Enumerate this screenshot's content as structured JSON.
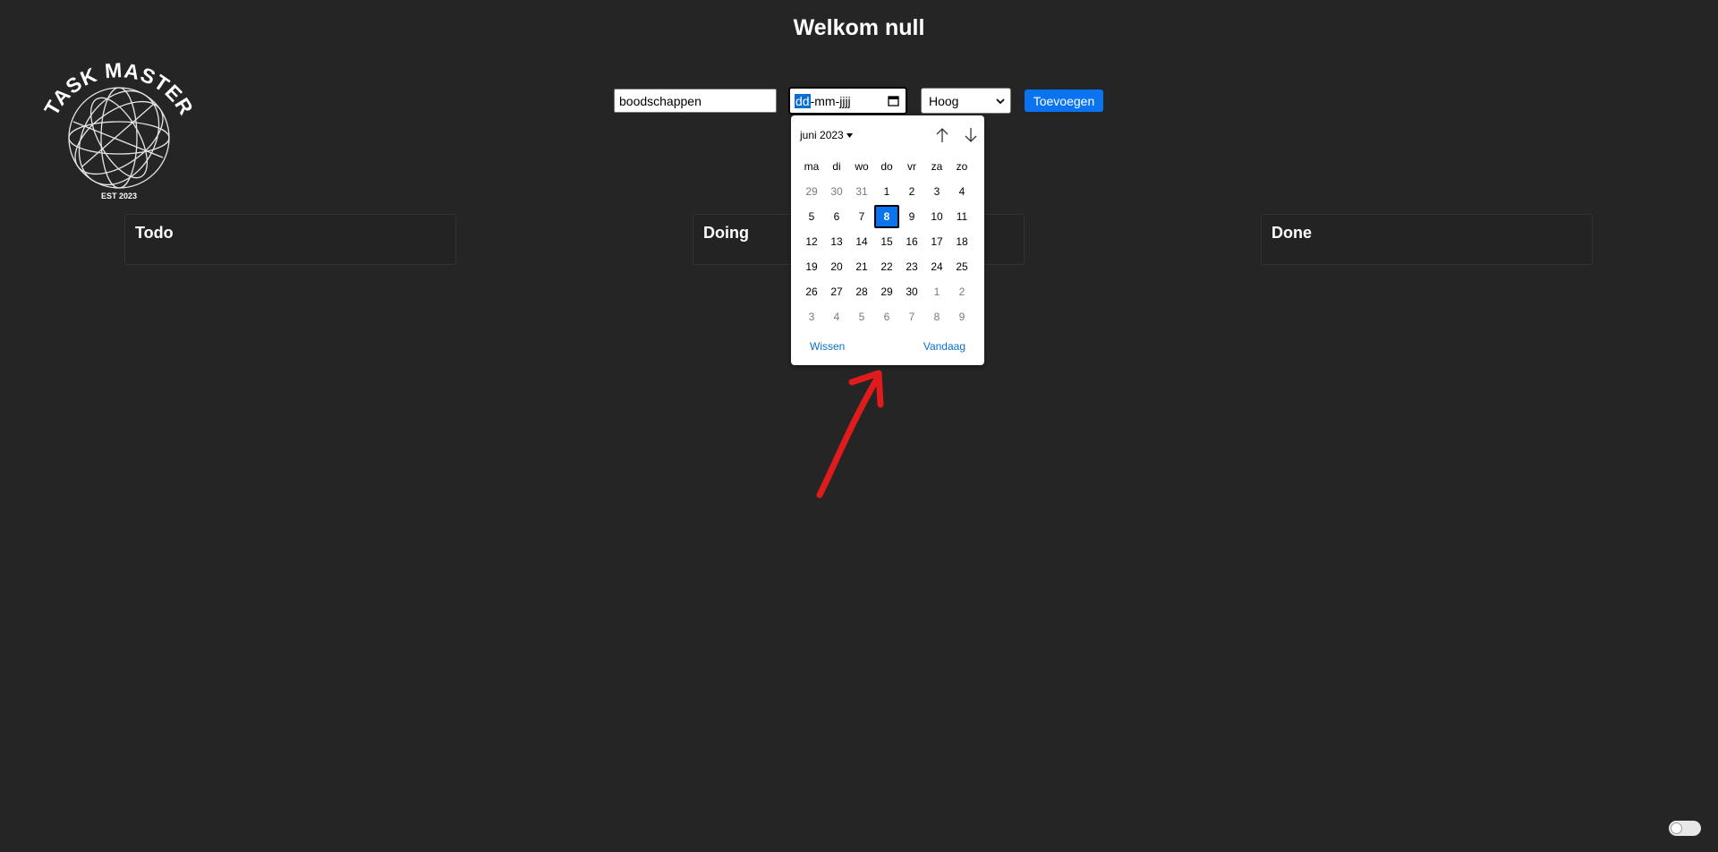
{
  "header": {
    "title": "Welkom null"
  },
  "logo": {
    "top_text": "TASK MASTER",
    "bottom_text": "EST 2023"
  },
  "form": {
    "task_value": "boodschappen",
    "date_day_segment": "dd",
    "date_rest": "-mm-jjjj",
    "priority_value": "Hoog",
    "add_label": "Toevoegen"
  },
  "columns": [
    {
      "title": "Todo"
    },
    {
      "title": "Doing"
    },
    {
      "title": "Done"
    }
  ],
  "datepicker": {
    "month_label": "juni 2023",
    "weekdays": [
      "ma",
      "di",
      "wo",
      "do",
      "vr",
      "za",
      "zo"
    ],
    "weeks": [
      [
        {
          "d": "29",
          "m": true
        },
        {
          "d": "30",
          "m": true
        },
        {
          "d": "31",
          "m": true
        },
        {
          "d": "1"
        },
        {
          "d": "2"
        },
        {
          "d": "3"
        },
        {
          "d": "4"
        }
      ],
      [
        {
          "d": "5"
        },
        {
          "d": "6"
        },
        {
          "d": "7"
        },
        {
          "d": "8",
          "sel": true
        },
        {
          "d": "9"
        },
        {
          "d": "10"
        },
        {
          "d": "11"
        }
      ],
      [
        {
          "d": "12"
        },
        {
          "d": "13"
        },
        {
          "d": "14"
        },
        {
          "d": "15"
        },
        {
          "d": "16"
        },
        {
          "d": "17"
        },
        {
          "d": "18"
        }
      ],
      [
        {
          "d": "19"
        },
        {
          "d": "20"
        },
        {
          "d": "21"
        },
        {
          "d": "22"
        },
        {
          "d": "23"
        },
        {
          "d": "24"
        },
        {
          "d": "25"
        }
      ],
      [
        {
          "d": "26"
        },
        {
          "d": "27"
        },
        {
          "d": "28"
        },
        {
          "d": "29"
        },
        {
          "d": "30"
        },
        {
          "d": "1",
          "m": true
        },
        {
          "d": "2",
          "m": true
        }
      ],
      [
        {
          "d": "3",
          "m": true
        },
        {
          "d": "4",
          "m": true
        },
        {
          "d": "5",
          "m": true
        },
        {
          "d": "6",
          "m": true
        },
        {
          "d": "7",
          "m": true
        },
        {
          "d": "8",
          "m": true
        },
        {
          "d": "9",
          "m": true
        }
      ]
    ],
    "clear_label": "Wissen",
    "today_label": "Vandaag"
  },
  "colors": {
    "background": "#252525",
    "accent": "#0a74f0",
    "annotation_arrow": "#e01b1b"
  },
  "icons": [
    "calendar-icon",
    "chevron-down-icon",
    "arrow-up-icon",
    "arrow-down-icon",
    "caret-down-icon",
    "globe-logo-icon"
  ]
}
